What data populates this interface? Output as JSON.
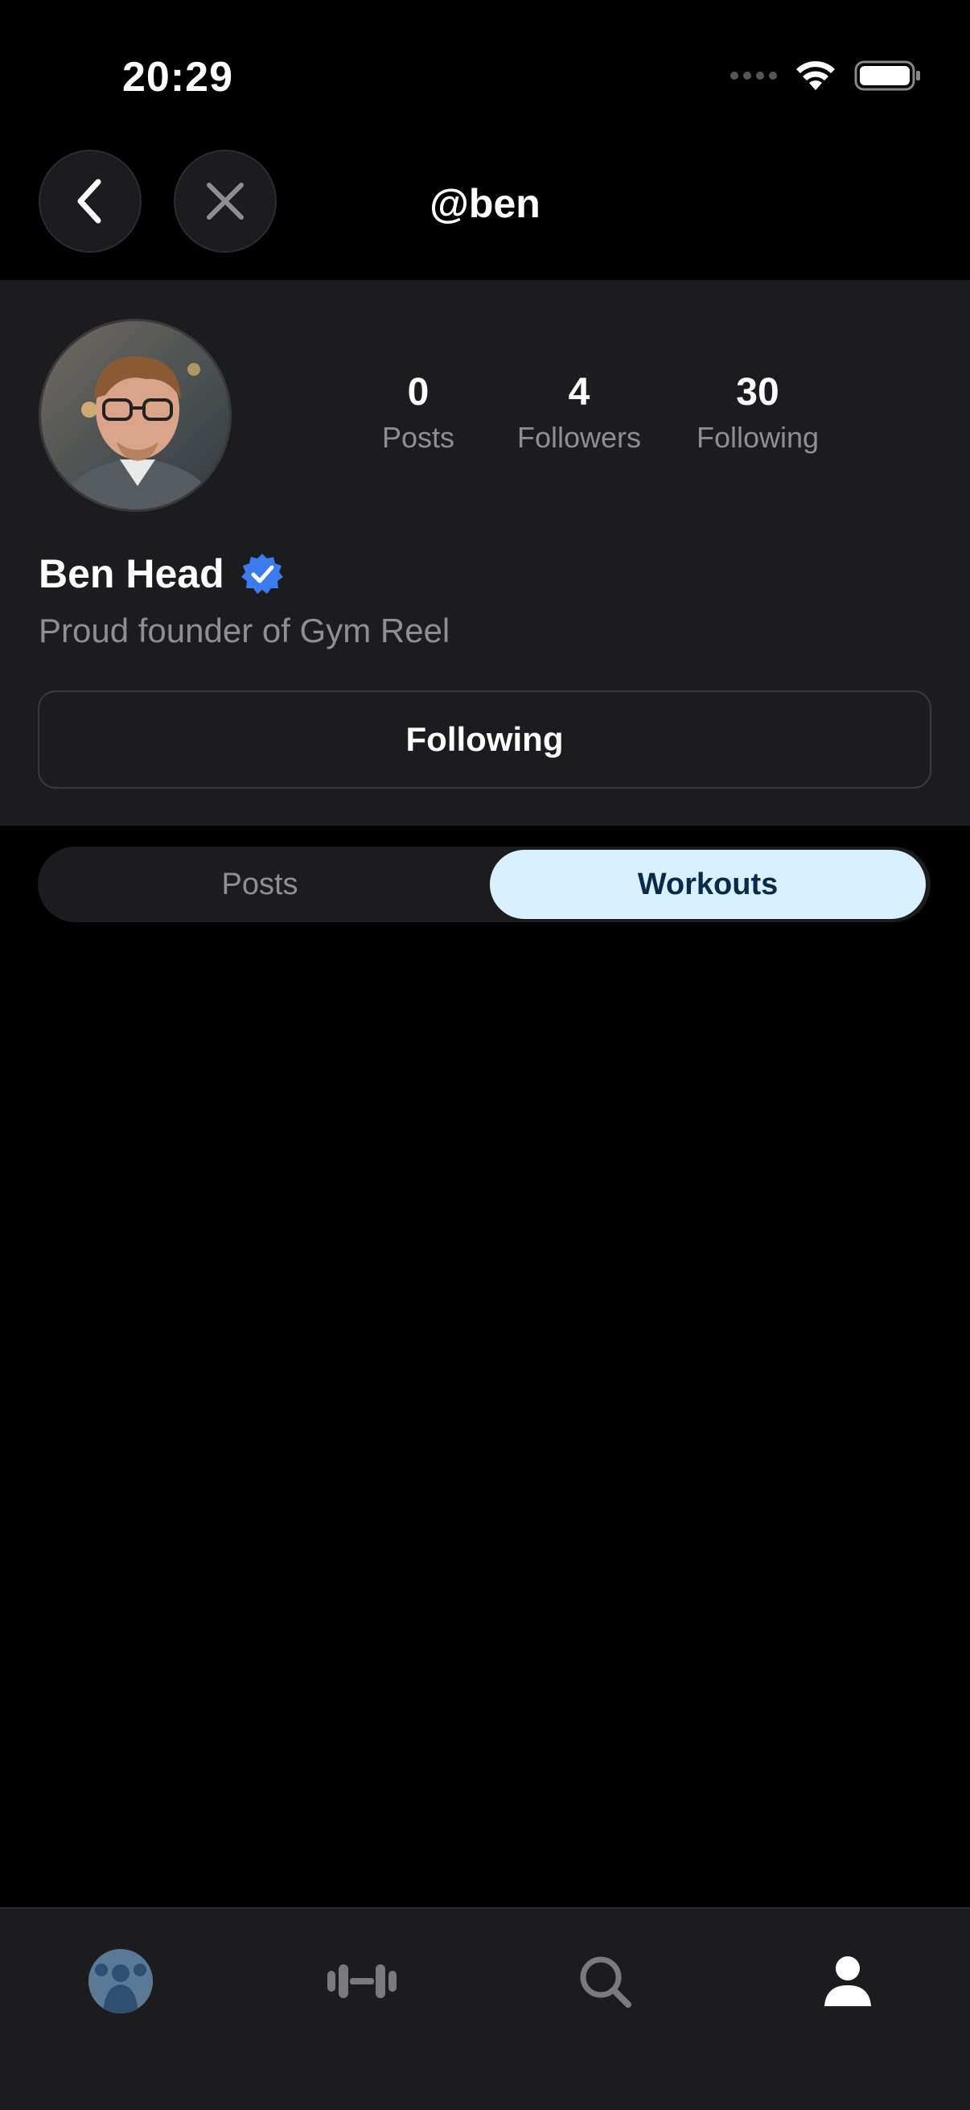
{
  "status": {
    "time": "20:29"
  },
  "nav": {
    "title": "@ben"
  },
  "profile": {
    "name": "Ben Head",
    "bio": "Proud founder of Gym Reel",
    "stats": {
      "posts": {
        "value": "0",
        "label": "Posts"
      },
      "followers": {
        "value": "4",
        "label": "Followers"
      },
      "following": {
        "value": "30",
        "label": "Following"
      }
    },
    "follow_button": "Following"
  },
  "segment": {
    "tabs": [
      "Posts",
      "Workouts"
    ],
    "selected": "Workouts"
  },
  "tabbar": {
    "items": [
      "app-logo-icon",
      "dumbbell-icon",
      "search-icon",
      "person-icon"
    ],
    "active": "person-icon"
  },
  "colors": {
    "background": "#000000",
    "surface": "#1c1c1e",
    "selected_segment": "#d8f0ff",
    "verified": "#3a7bf0"
  }
}
